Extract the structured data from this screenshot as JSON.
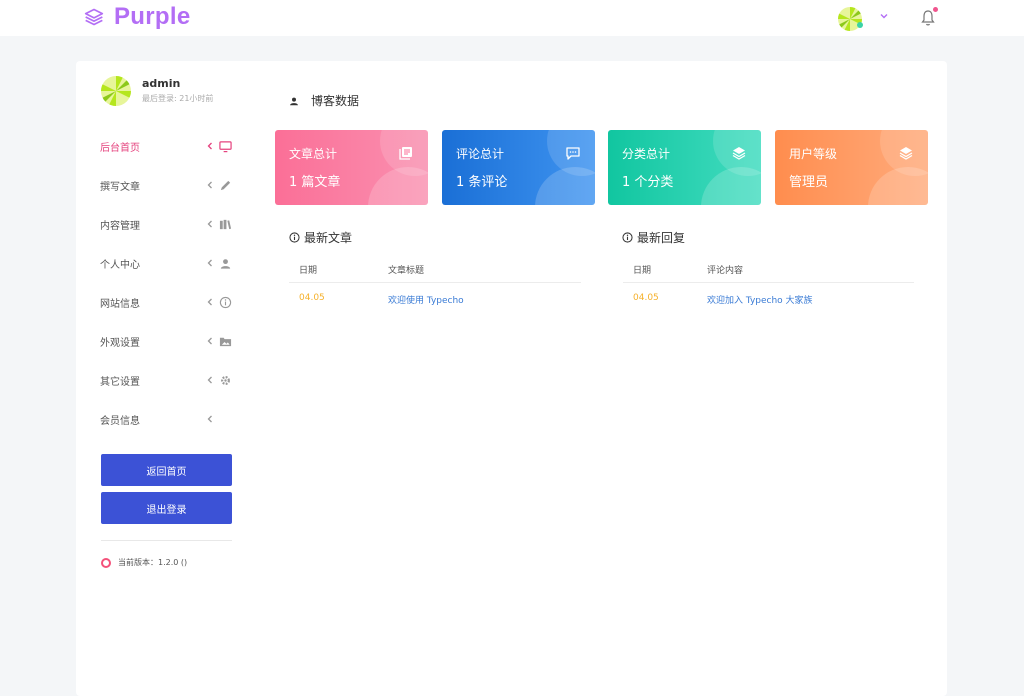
{
  "brand": {
    "name": "Purple"
  },
  "colors": {
    "accent": "#b36ef5",
    "active_nav": "#e5427e",
    "button": "#3c52d6",
    "date": "#f5b12b",
    "link": "#3a7bd5"
  },
  "profile": {
    "name": "admin",
    "last_login": "最后登录: 21小时前"
  },
  "sidebar": {
    "items": [
      {
        "label": "后台首页",
        "icon": "monitor-icon"
      },
      {
        "label": "撰写文章",
        "icon": "pencil-icon"
      },
      {
        "label": "内容管理",
        "icon": "book-icon"
      },
      {
        "label": "个人中心",
        "icon": "user-icon"
      },
      {
        "label": "网站信息",
        "icon": "info-icon"
      },
      {
        "label": "外观设置",
        "icon": "folder-image-icon"
      },
      {
        "label": "其它设置",
        "icon": "gear-icon"
      },
      {
        "label": "会员信息",
        "icon": ""
      }
    ],
    "home_button": "返回首页",
    "logout_button": "退出登录",
    "version": "当前版本：1.2.0 ()"
  },
  "main": {
    "section_title": "博客数据",
    "cards": [
      {
        "title": "文章总计",
        "value": "1 篇文章",
        "icon": "articles-icon"
      },
      {
        "title": "评论总计",
        "value": "1 条评论",
        "icon": "comment-icon"
      },
      {
        "title": "分类总计",
        "value": "1 个分类",
        "icon": "layers-icon"
      },
      {
        "title": "用户等级",
        "value": "管理员",
        "icon": "layers-icon"
      }
    ],
    "recent_posts": {
      "title": "最新文章",
      "columns": [
        "日期",
        "文章标题"
      ],
      "rows": [
        {
          "date": "04.05",
          "title": "欢迎使用 Typecho"
        }
      ]
    },
    "recent_comments": {
      "title": "最新回复",
      "columns": [
        "日期",
        "评论内容"
      ],
      "rows": [
        {
          "date": "04.05",
          "content": "欢迎加入 Typecho 大家族"
        }
      ]
    }
  }
}
